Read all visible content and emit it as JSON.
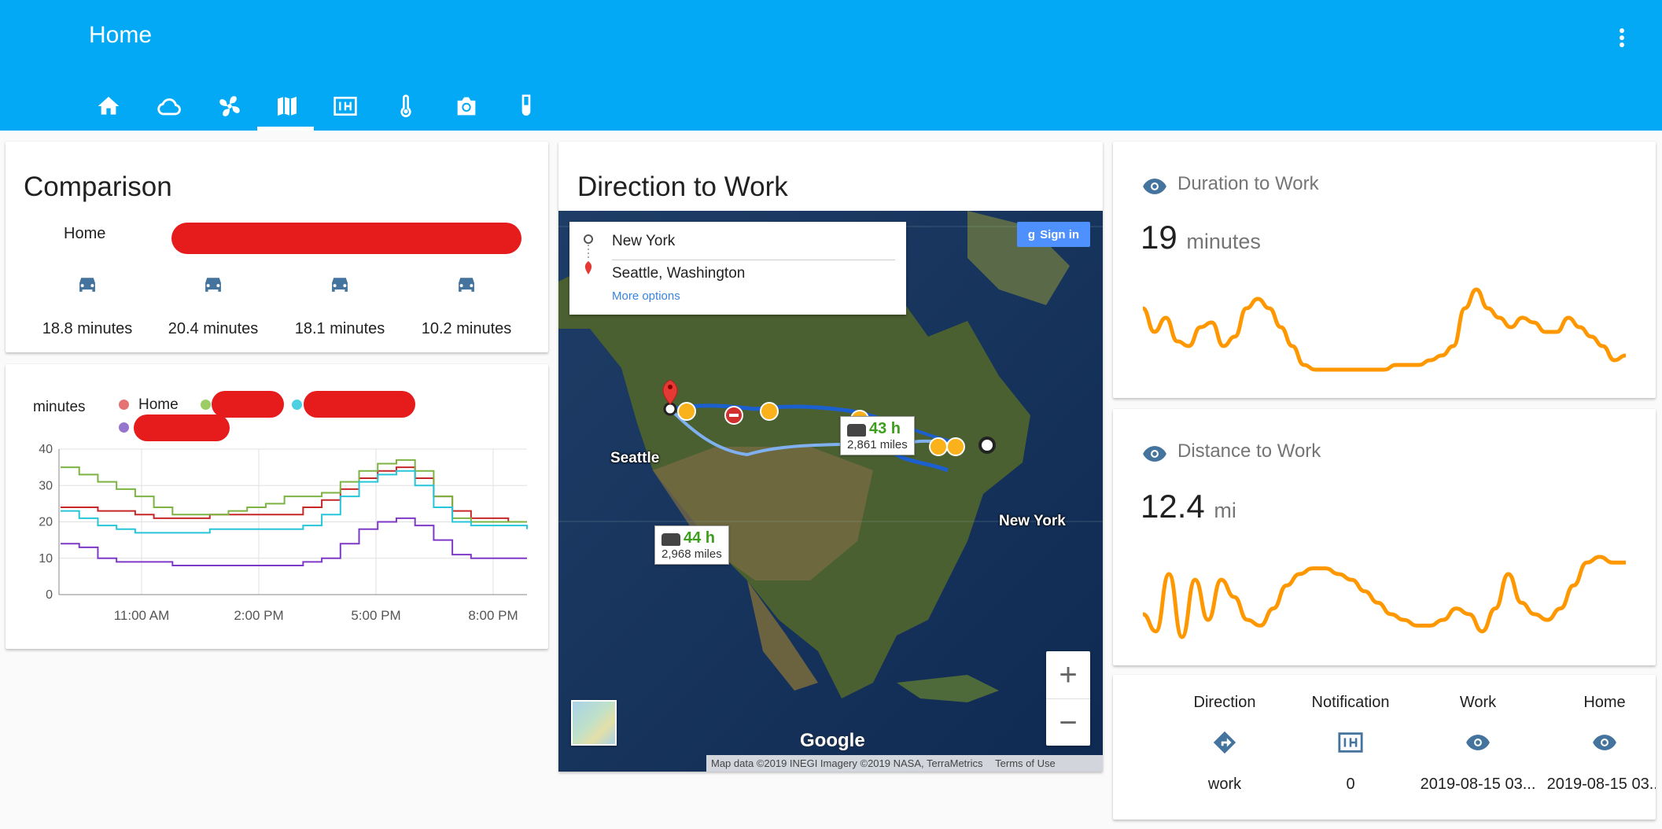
{
  "header": {
    "title": "Home",
    "tabs": [
      {
        "icon": "home-icon"
      },
      {
        "icon": "cloud-icon"
      },
      {
        "icon": "fan-icon"
      },
      {
        "icon": "map-icon",
        "active": true
      },
      {
        "icon": "numeric-icon"
      },
      {
        "icon": "thermometer-icon"
      },
      {
        "icon": "camera-icon"
      },
      {
        "icon": "test-tube-icon"
      }
    ],
    "menu_icon": "dots-vertical-icon"
  },
  "colors": {
    "primary": "#03a9f4",
    "accent": "#ff9800",
    "icon": "#44739e",
    "redaction": "#e61b1b"
  },
  "comparison": {
    "title": "Comparison",
    "row_label": "Home",
    "items": [
      {
        "icon": "car-icon",
        "value": "18.8 minutes"
      },
      {
        "icon": "car-icon",
        "value": "20.4 minutes"
      },
      {
        "icon": "car-icon",
        "value": "18.1 minutes"
      },
      {
        "icon": "car-icon",
        "value": "10.2 minutes"
      }
    ]
  },
  "history_chart": {
    "unit_label": "minutes",
    "legend": [
      {
        "name": "Home",
        "color": "#e57373"
      }
    ],
    "chart_data": {
      "type": "line",
      "x_ticks": [
        "11:00 AM",
        "2:00 PM",
        "5:00 PM",
        "8:00 PM"
      ],
      "y_ticks": [
        "0",
        "10",
        "20",
        "30",
        "40"
      ],
      "ylim": [
        0,
        40
      ],
      "grid": true,
      "series": [
        {
          "name": "Home",
          "color": "#c62828",
          "values": [
            24,
            24,
            23,
            23,
            22,
            21,
            21,
            21,
            22,
            22,
            22,
            22,
            22,
            24,
            26,
            29,
            32,
            34,
            35,
            32,
            27,
            23,
            21,
            21,
            20,
            20
          ]
        },
        {
          "color": "#7cb342",
          "values": [
            35,
            33,
            31,
            29,
            27,
            24,
            22,
            22,
            22,
            23,
            24,
            25,
            27,
            27,
            28,
            31,
            34,
            36,
            37,
            34,
            27,
            21,
            20,
            20,
            20,
            20
          ]
        },
        {
          "color": "#26c6da",
          "values": [
            23,
            21,
            19,
            18,
            17,
            17,
            17,
            17,
            18,
            18,
            18,
            18,
            18,
            19,
            22,
            27,
            31,
            33,
            34,
            30,
            24,
            20,
            19,
            19,
            19,
            18
          ]
        },
        {
          "color": "#7e3ac7",
          "values": [
            14,
            13,
            10,
            9,
            9,
            9,
            8,
            8,
            8,
            8,
            8,
            8,
            8,
            9,
            10,
            14,
            18,
            20,
            21,
            19,
            15,
            11,
            10,
            10,
            10,
            10
          ]
        }
      ]
    }
  },
  "direction": {
    "title": "Direction to Work",
    "from": "New York",
    "to": "Seattle, Washington",
    "more_options": "More options",
    "sign_in": "Sign in",
    "routes": [
      {
        "time": "43 h",
        "distance": "2,861 miles"
      },
      {
        "time": "44 h",
        "distance": "2,968 miles"
      }
    ],
    "labels": {
      "origin": "Seattle",
      "destination": "New York"
    },
    "zoom_in": "+",
    "zoom_out": "−",
    "attribution": "Map data ©2019 INEGI Imagery ©2019 NASA, TerraMetrics",
    "terms": "Terms of Use",
    "brand": "Google"
  },
  "duration": {
    "title": "Duration to Work",
    "icon": "eye-icon",
    "value": "19",
    "unit": "minutes",
    "sparkline": [
      14,
      9,
      12,
      7,
      6,
      10,
      11,
      6,
      8,
      14,
      16,
      14,
      10,
      6,
      2,
      1,
      1,
      1,
      1,
      1,
      1,
      1,
      2,
      2,
      2,
      3,
      4,
      6,
      14,
      18,
      14,
      12,
      10,
      12,
      11,
      9,
      9,
      12,
      10,
      8,
      6,
      3,
      4
    ]
  },
  "distance": {
    "title": "Distance to Work",
    "icon": "eye-icon",
    "value": "12.4",
    "unit": "mi",
    "sparkline": [
      5,
      2,
      12,
      1,
      11,
      4,
      11,
      8,
      4,
      3,
      6,
      10,
      12,
      13,
      13,
      12,
      11,
      9,
      7,
      5,
      4,
      3,
      3,
      4,
      6,
      5,
      2,
      6,
      12,
      7,
      5,
      4,
      6,
      10,
      14,
      15,
      14,
      14
    ]
  },
  "entities": [
    {
      "label": "Direction",
      "icon": "directions-icon",
      "state": "work"
    },
    {
      "label": "Notification",
      "icon": "numeric-icon",
      "state": "0"
    },
    {
      "label": "Work",
      "icon": "eye-icon",
      "state": "2019-08-15 03..."
    },
    {
      "label": "Home",
      "icon": "eye-icon",
      "state": "2019-08-15 03..."
    }
  ]
}
